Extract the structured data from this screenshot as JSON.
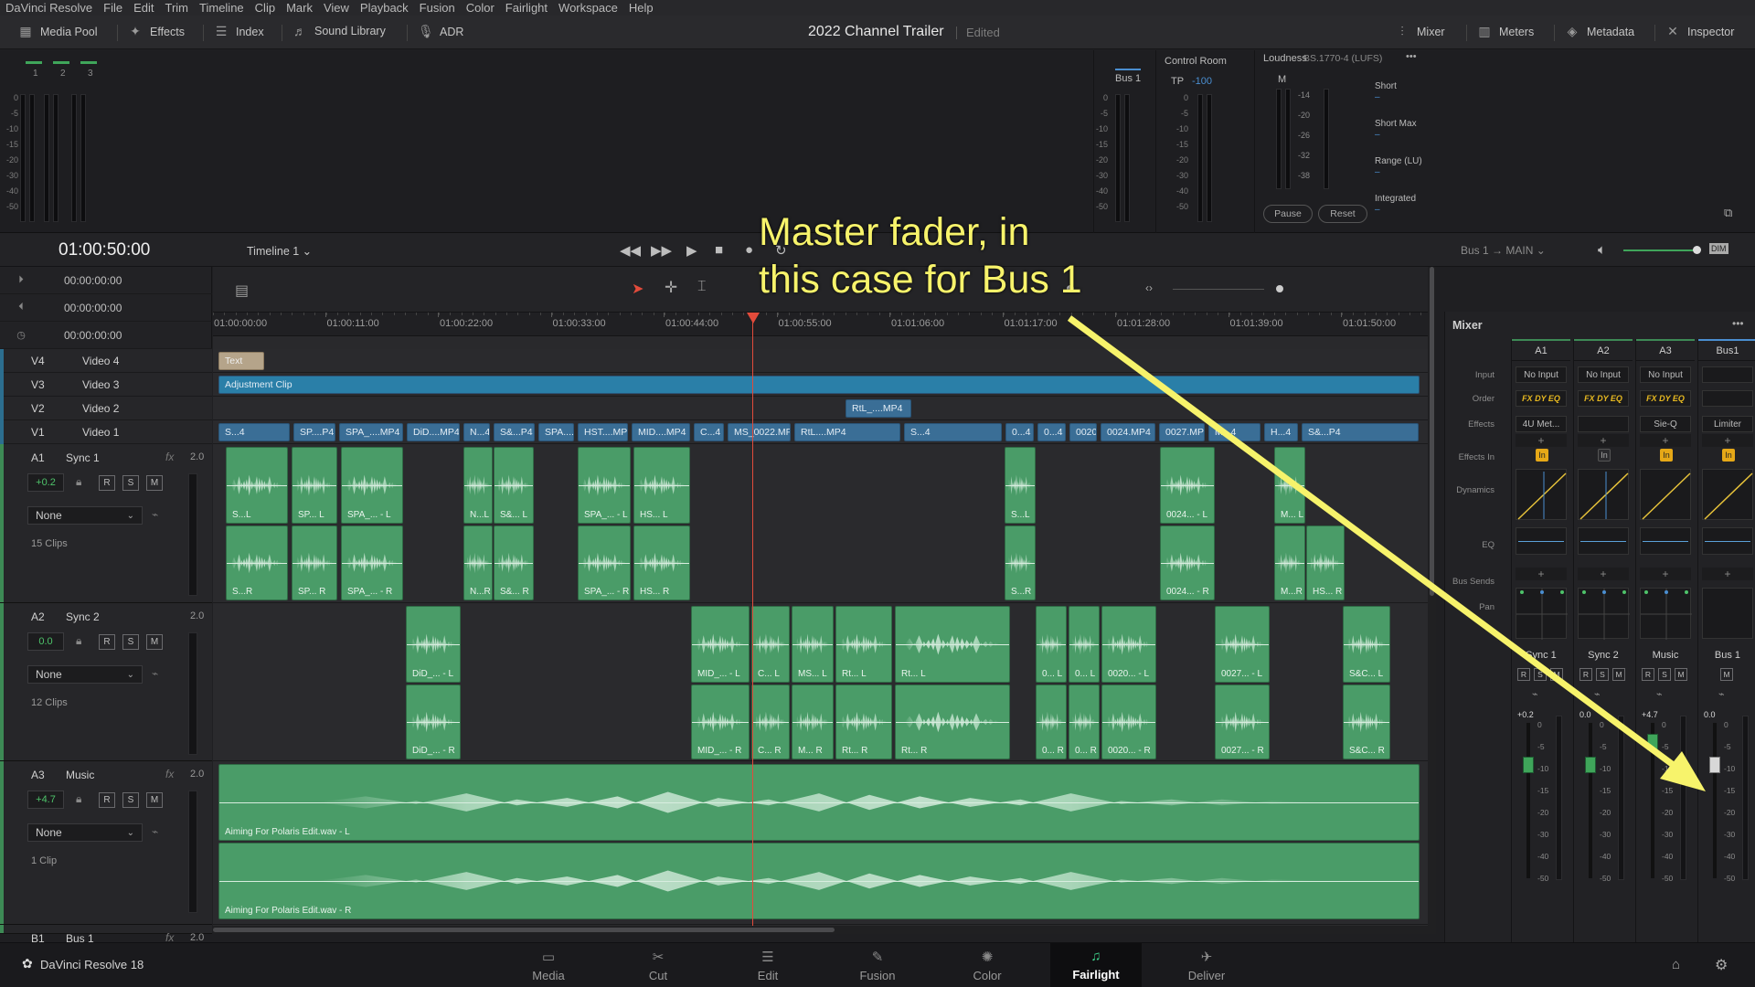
{
  "menu": [
    "DaVinci Resolve",
    "File",
    "Edit",
    "Trim",
    "Timeline",
    "Clip",
    "Mark",
    "View",
    "Playback",
    "Fusion",
    "Color",
    "Fairlight",
    "Workspace",
    "Help"
  ],
  "toolbar": {
    "left": [
      {
        "label": "Media Pool",
        "icon": "media-pool-icon"
      },
      {
        "label": "Effects",
        "icon": "effects-icon"
      },
      {
        "label": "Index",
        "icon": "index-icon"
      },
      {
        "label": "Sound Library",
        "icon": "sound-library-icon"
      },
      {
        "label": "ADR",
        "icon": "microphone-icon"
      }
    ],
    "right": [
      {
        "label": "Mixer",
        "icon": "mixer-icon"
      },
      {
        "label": "Meters",
        "icon": "meters-icon"
      },
      {
        "label": "Metadata",
        "icon": "metadata-icon"
      },
      {
        "label": "Inspector",
        "icon": "inspector-icon"
      }
    ],
    "project_title": "2022 Channel Trailer",
    "project_status": "Edited"
  },
  "meters": {
    "track_numbers": [
      "1",
      "2",
      "3"
    ],
    "scale": [
      "0",
      "-5",
      "-10",
      "-15",
      "-20",
      "-30",
      "-40",
      "-50"
    ],
    "bus_label": "Bus 1",
    "control_room": "Control Room",
    "tp_label": "TP",
    "tp_value": "-100",
    "loudness_title": "Loudness",
    "loudness_standard": "BS.1770-4 (LUFS)",
    "m_label": "M",
    "loud_scale": [
      "-14",
      "-20",
      "-26",
      "-32",
      "-38"
    ],
    "loudness_rows": [
      "Short",
      "Short Max",
      "Range (LU)",
      "Integrated"
    ],
    "pause": "Pause",
    "reset": "Reset"
  },
  "transport": {
    "timecode": "01:00:50:00",
    "timeline_name": "Timeline 1",
    "bus_out": "Bus 1",
    "main": "MAIN",
    "dim": "DIM"
  },
  "timecode_rows": [
    "00:00:00:00",
    "00:00:00:00",
    "00:00:00:00"
  ],
  "ruler": [
    "01:00:00:00",
    "01:00:11:00",
    "01:00:22:00",
    "01:00:33:00",
    "01:00:44:00",
    "01:00:55:00",
    "01:01:06:00",
    "01:01:17:00",
    "01:01:28:00",
    "01:01:39:00",
    "01:01:50:00"
  ],
  "video_tracks": [
    {
      "id": "V4",
      "name": "Video 4"
    },
    {
      "id": "V3",
      "name": "Video 3"
    },
    {
      "id": "V2",
      "name": "Video 2"
    },
    {
      "id": "V1",
      "name": "Video 1"
    }
  ],
  "video_clips": {
    "v4": "Text",
    "v3": "Adjustment Clip",
    "v2": "RtL_....MP4",
    "v1": [
      "S...4",
      "SP....P4",
      "SPA_....MP4",
      "DiD....MP4",
      "N...4",
      "S&...P4",
      "SPA....MP4",
      "HST....MP4",
      "MID....MP4",
      "C...4",
      "MS_0022.MP4",
      "RtL....MP4",
      "S...4",
      "0...4",
      "0...4",
      "0020.MP4",
      "0024.MP4",
      "0027.MP4",
      "M...4",
      "H...4",
      "S&...P4"
    ]
  },
  "audio_tracks": [
    {
      "id": "A1",
      "name": "Sync 1",
      "fx": "fx",
      "ch": "2.0",
      "vol": "+0.2",
      "sel": "None",
      "clips": "15 Clips"
    },
    {
      "id": "A2",
      "name": "Sync 2",
      "fx": "",
      "ch": "2.0",
      "vol": "0.0",
      "sel": "None",
      "clips": "12 Clips"
    },
    {
      "id": "A3",
      "name": "Music",
      "fx": "fx",
      "ch": "2.0",
      "vol": "+4.7",
      "sel": "None",
      "clips": "1 Clip"
    },
    {
      "id": "B1",
      "name": "Bus 1",
      "fx": "fx",
      "ch": "2.0"
    }
  ],
  "rsm": [
    "R",
    "S",
    "M"
  ],
  "audio_clips": {
    "a1_top": [
      "S...L",
      "SP... L",
      "SPA_... - L",
      "N...L",
      "S&... L",
      "SPA_... - L",
      "HS... L"
    ],
    "a1_top_right": [
      "S...L",
      "0024... - L",
      "M... L"
    ],
    "a1_bot": [
      "S...R",
      "SP... R",
      "SPA_... - R",
      "N...R",
      "S&... R",
      "SPA_... - R",
      "HS... R"
    ],
    "a1_bot_right": [
      "S...R",
      "0024... - R",
      "M...R",
      "HS... R"
    ],
    "a2_top": [
      "DiD_... - L",
      "MID_... - L",
      "C... L",
      "MS... L",
      "Rt... L",
      "Rt... L",
      "0... L",
      "0... L",
      "0020... - L",
      "0027... - L",
      "S&C... L"
    ],
    "a2_bot": [
      "DiD_... - R",
      "MID_... - R",
      "C... R",
      "M... R",
      "Rt... R",
      "Rt... R",
      "0... R",
      "0... R",
      "0020... - R",
      "0027... - R",
      "S&C... R"
    ],
    "a3_top": "Aiming For Polaris Edit.wav - L",
    "a3_bot": "Aiming For Polaris Edit.wav - R"
  },
  "mixer": {
    "title": "Mixer",
    "columns": [
      "A1",
      "A2",
      "A3",
      "Bus1"
    ],
    "row_labels": [
      "Input",
      "Order",
      "Effects",
      "Effects In",
      "Dynamics",
      "EQ",
      "Bus Sends",
      "Pan"
    ],
    "input": [
      "No Input",
      "No Input",
      "No Input",
      ""
    ],
    "order": [
      "FX DY EQ",
      "FX DY EQ",
      "FX DY EQ",
      ""
    ],
    "effects": [
      "4U Met...",
      "",
      "Sie-Q",
      "Limiter"
    ],
    "effects_in": "In",
    "names": [
      "Sync 1",
      "Sync 2",
      "Music",
      "Bus 1"
    ],
    "values": [
      "+0.2",
      "0.0",
      "+4.7",
      "0.0"
    ],
    "scale": [
      "0",
      "-5",
      "-10",
      "-15",
      "-20",
      "-30",
      "-40",
      "-50"
    ],
    "fader_levels_db": [
      -10,
      -10,
      -5,
      -10
    ]
  },
  "pages": [
    {
      "label": "Media",
      "icon": "media-page-icon",
      "glyph": "▭"
    },
    {
      "label": "Cut",
      "icon": "cut-page-icon",
      "glyph": "✂"
    },
    {
      "label": "Edit",
      "icon": "edit-page-icon",
      "glyph": "☰"
    },
    {
      "label": "Fusion",
      "icon": "fusion-page-icon",
      "glyph": "✎"
    },
    {
      "label": "Color",
      "icon": "color-page-icon",
      "glyph": "✺"
    },
    {
      "label": "Fairlight",
      "icon": "fairlight-page-icon",
      "glyph": "♫",
      "active": true
    },
    {
      "label": "Deliver",
      "icon": "deliver-page-icon",
      "glyph": "✈"
    }
  ],
  "brand": "DaVinci Resolve 18",
  "annotation": {
    "line1": "Master fader, in",
    "line2": "this case for Bus 1",
    "color": "#f7f36b"
  }
}
